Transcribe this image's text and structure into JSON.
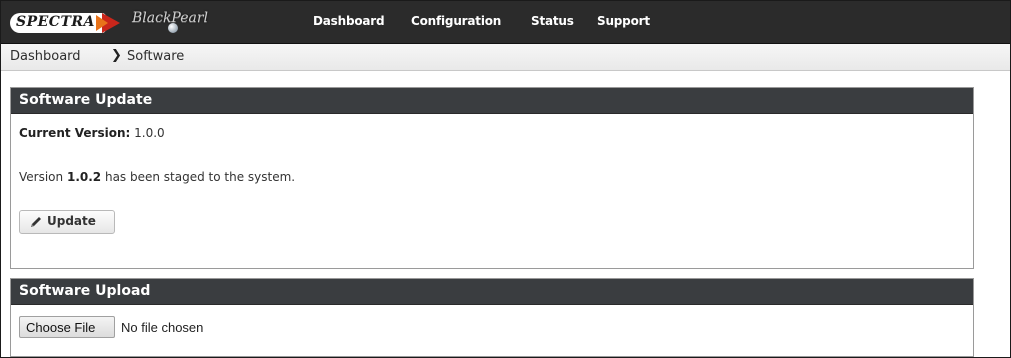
{
  "header": {
    "brand": "SPECTRA",
    "product": "BlackPearl",
    "nav": [
      "Dashboard",
      "Configuration",
      "Status",
      "Support"
    ]
  },
  "breadcrumb": {
    "root": "Dashboard",
    "current": "Software"
  },
  "software_update": {
    "title": "Software Update",
    "current_version_label": "Current Version:",
    "current_version_value": "1.0.0",
    "staged_prefix": "Version",
    "staged_version": "1.0.2",
    "staged_suffix": "has been staged to the system.",
    "update_button": "Update"
  },
  "software_upload": {
    "title": "Software Upload",
    "choose_file_button": "Choose File",
    "file_status": "No file chosen"
  },
  "colors": {
    "header_bg": "#2b2b2b",
    "panel_header_bg": "#3a3d40",
    "brand_red": "#c9261b",
    "brand_orange": "#e8731a"
  }
}
